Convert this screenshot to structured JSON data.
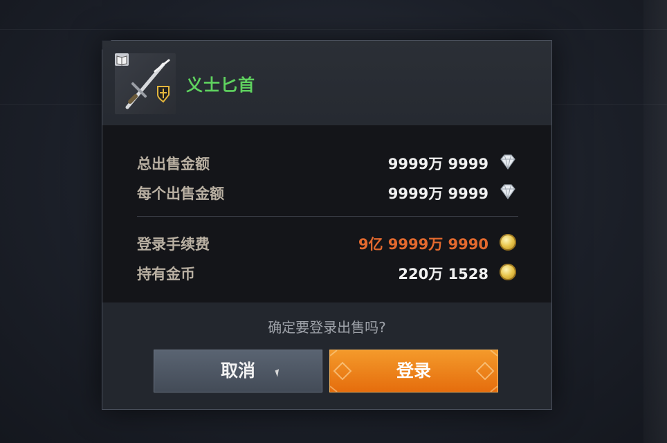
{
  "item": {
    "name": "义士匕首"
  },
  "summary": [
    {
      "label": "总出售金额",
      "value": "9999万 9999",
      "currency_icon": "diamond-icon"
    },
    {
      "label": "每个出售金额",
      "value": "9999万 9999",
      "currency_icon": "diamond-icon"
    }
  ],
  "costs": [
    {
      "label": "登录手续费",
      "value": "9亿 9999万 9990",
      "currency_icon": "gold-coin-icon",
      "color": "#e3692e"
    },
    {
      "label": "持有金币",
      "value": "220万 1528",
      "currency_icon": "gold-coin-icon",
      "color": "#f1f1f1"
    }
  ],
  "confirm": {
    "question": "确定要登录出售吗?",
    "cancel_label": "取消",
    "login_label": "登录"
  },
  "colors": {
    "item_name": "#5fd25f",
    "fee_value": "#e3692e",
    "login_button": "#ec7f1a",
    "cancel_button": "#4d5561"
  }
}
